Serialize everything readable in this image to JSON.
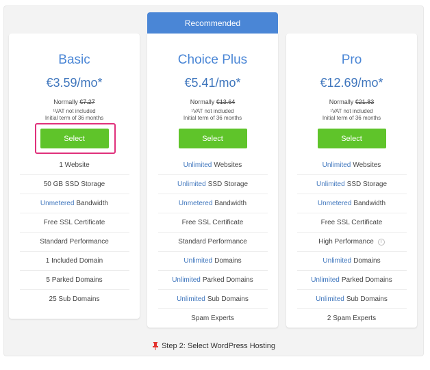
{
  "recommended_label": "Recommended",
  "plans": [
    {
      "name": "Basic",
      "price": "€3.59/mo*",
      "normally_prefix": "Normally ",
      "normally_price": "€7.27",
      "vat": "¹VAT not included",
      "term": "Initial term of 36 months",
      "select_label": "Select",
      "features": [
        {
          "hl": "",
          "text": "1 Website"
        },
        {
          "hl": "",
          "text": "50 GB SSD Storage"
        },
        {
          "hl": "Unmetered",
          "text": "Bandwidth"
        },
        {
          "hl": "",
          "text": "Free SSL Certificate"
        },
        {
          "hl": "",
          "text": "Standard Performance"
        },
        {
          "hl": "",
          "text": "1 Included Domain"
        },
        {
          "hl": "",
          "text": "5 Parked Domains"
        },
        {
          "hl": "",
          "text": "25 Sub Domains"
        }
      ]
    },
    {
      "name": "Choice Plus",
      "price": "€5.41/mo*",
      "normally_prefix": "Normally ",
      "normally_price": "€13.64",
      "vat": "¹VAT not included",
      "term": "Initial term of 36 months",
      "select_label": "Select",
      "features": [
        {
          "hl": "Unlimited",
          "text": "Websites"
        },
        {
          "hl": "Unlimited",
          "text": "SSD Storage"
        },
        {
          "hl": "Unmetered",
          "text": "Bandwidth"
        },
        {
          "hl": "",
          "text": "Free SSL Certificate"
        },
        {
          "hl": "",
          "text": "Standard Performance"
        },
        {
          "hl": "Unlimited",
          "text": "Domains"
        },
        {
          "hl": "Unlimited",
          "text": "Parked Domains"
        },
        {
          "hl": "Unlimited",
          "text": "Sub Domains"
        },
        {
          "hl": "",
          "text": "Spam Experts"
        }
      ]
    },
    {
      "name": "Pro",
      "price": "€12.69/mo*",
      "normally_prefix": "Normally ",
      "normally_price": "€21.83",
      "vat": "¹VAT not included",
      "term": "Initial term of 36 months",
      "select_label": "Select",
      "features": [
        {
          "hl": "Unlimited",
          "text": "Websites"
        },
        {
          "hl": "Unlimited",
          "text": "SSD Storage"
        },
        {
          "hl": "Unmetered",
          "text": "Bandwidth"
        },
        {
          "hl": "",
          "text": "Free SSL Certificate"
        },
        {
          "hl": "",
          "text": "High Performance",
          "info": "i"
        },
        {
          "hl": "Unlimited",
          "text": "Domains"
        },
        {
          "hl": "Unlimited",
          "text": "Parked Domains"
        },
        {
          "hl": "Unlimited",
          "text": "Sub Domains"
        },
        {
          "hl": "",
          "text": "2 Spam Experts"
        }
      ]
    }
  ],
  "caption": "Step 2: Select WordPress Hosting",
  "icons": {
    "caption_icon": "pushpin-icon",
    "info_icon": "info-circle-icon"
  },
  "colors": {
    "accent": "#4a86d6",
    "button": "#5fc42a",
    "highlight": "#e0307b",
    "pin": "#e3342f"
  }
}
